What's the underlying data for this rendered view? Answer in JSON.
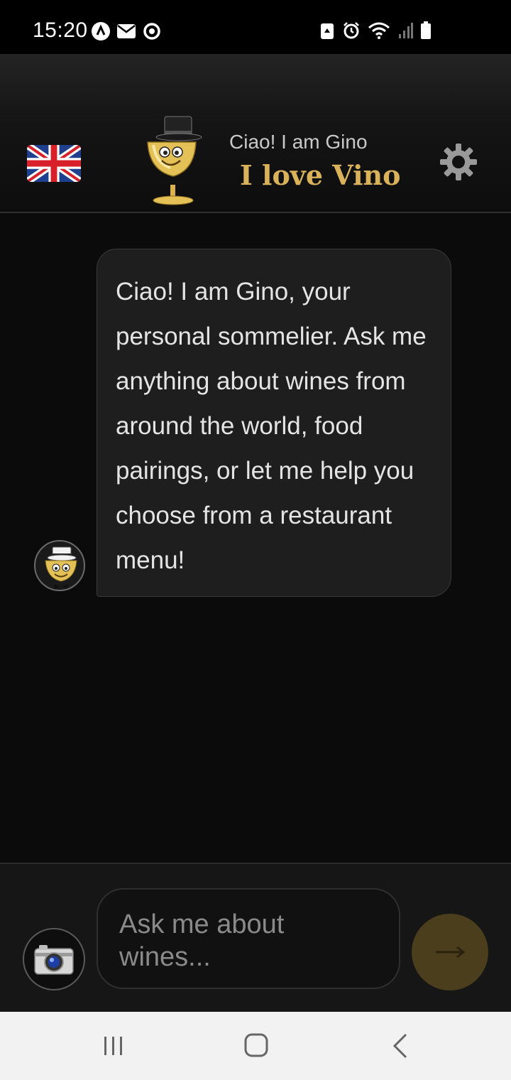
{
  "status_bar": {
    "time": "15:20",
    "left_icons": [
      "app-icon",
      "mail-icon",
      "sync-icon"
    ],
    "right_icons": [
      "recycle-icon",
      "alarm-icon",
      "wifi-icon",
      "signal-icon",
      "battery-icon"
    ]
  },
  "header": {
    "language_flag": "uk-flag-icon",
    "greeting": "Ciao! I am Gino",
    "brand": "I love Vino",
    "settings_icon": "gear-icon"
  },
  "chat": {
    "messages": [
      {
        "sender": "assistant",
        "text": "Ciao! I am Gino, your personal sommelier. Ask me anything about wines from around the world, food pairings, or let me help you choose from a restaurant menu!"
      }
    ]
  },
  "composer": {
    "placeholder": "Ask me about wines...",
    "value": "",
    "camera_icon": "camera-icon",
    "send_icon": "arrow-right-icon"
  },
  "nav_bar": {
    "items": [
      "recent-apps-icon",
      "home-icon",
      "back-icon"
    ]
  },
  "colors": {
    "brand_gold": "#d9b25a",
    "send_button": "#4b3e1d",
    "background": "#0b0b0b"
  }
}
